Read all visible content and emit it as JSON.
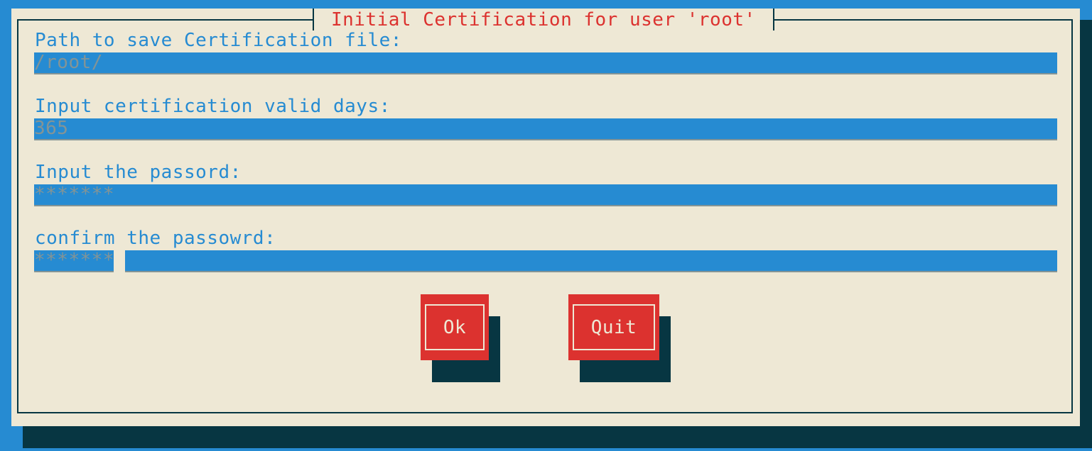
{
  "dialog": {
    "title": "Initial Certification for user 'root'"
  },
  "fields": {
    "path": {
      "label": "Path to save Certification file:",
      "value": "/root/"
    },
    "days": {
      "label": "Input certification valid days:",
      "value": "365"
    },
    "password": {
      "label": "Input the passord:",
      "value": "*******"
    },
    "confirm": {
      "label": "confirm the passowrd:",
      "value": "*******"
    }
  },
  "buttons": {
    "ok": "Ok",
    "quit": "Quit"
  },
  "colors": {
    "background": "#268bd2",
    "dialog": "#eee8d5",
    "shadow": "#073642",
    "accent": "#dc322f",
    "field_text": "#839496"
  }
}
